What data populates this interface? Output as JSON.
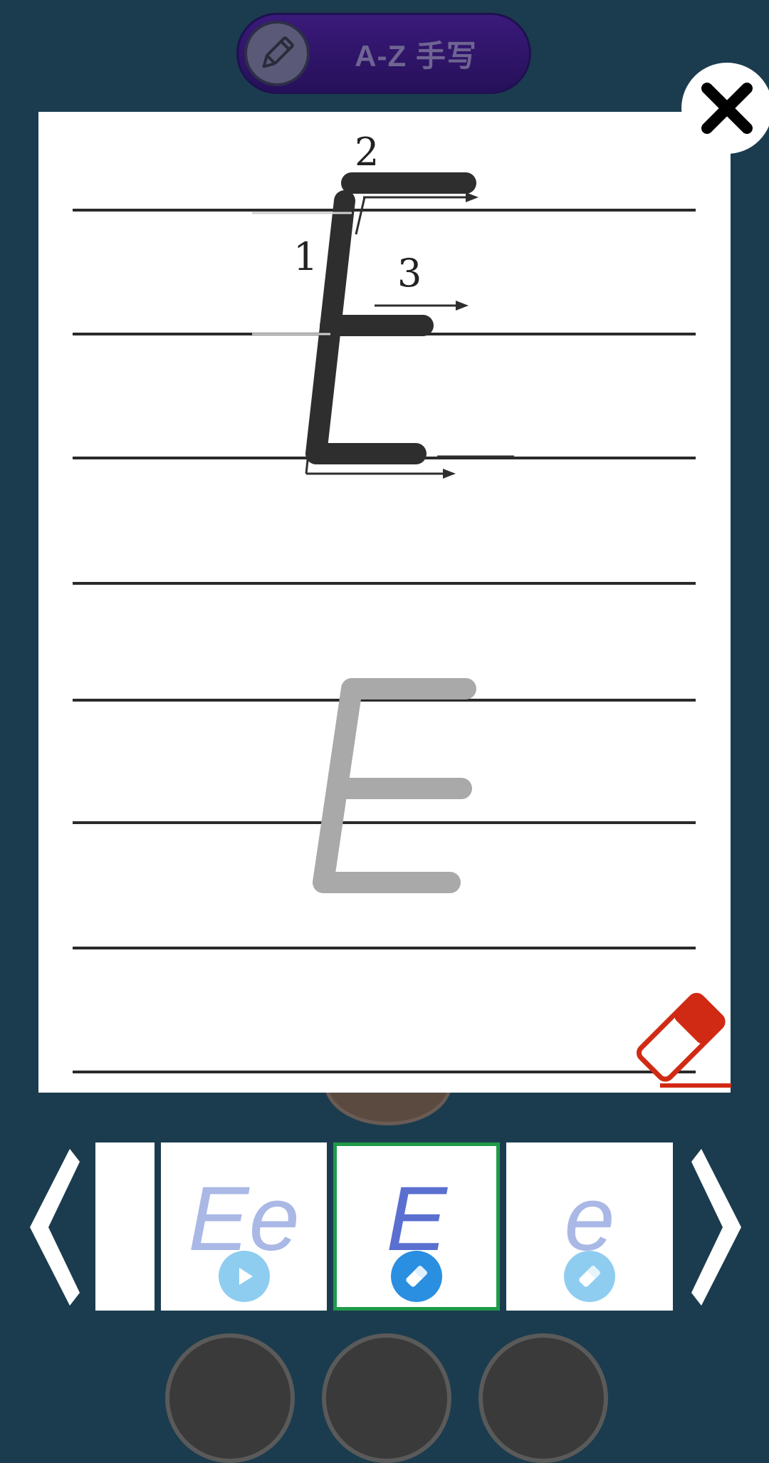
{
  "header": {
    "title": "A-Z 手写",
    "pencil_icon": "pencil-icon"
  },
  "close_icon": "close-icon",
  "letter": {
    "main": "E"
  },
  "stroke_numbers": [
    "1",
    "2",
    "3"
  ],
  "eraser_icon": "eraser-icon",
  "colors": {
    "background": "#1b3c4e",
    "pill": "#2e1366",
    "eraser_red": "#d12a14",
    "thumb_letter": "#aab8e6",
    "thumb_letter_selected": "#5a6fd0",
    "play_icon_bg": "#8fcdf0",
    "edit_icon_bg": "#2a8fe0",
    "selected_border": "#1f9a4a"
  },
  "carousel": {
    "items": [
      {
        "label": "",
        "icon": ""
      },
      {
        "label": "Ee",
        "icon": "play-icon"
      },
      {
        "label": "E",
        "icon": "eraser-icon",
        "selected": true
      },
      {
        "label": "e",
        "icon": "eraser-icon"
      }
    ],
    "prev_icon": "chevron-left-icon",
    "next_icon": "chevron-right-icon"
  }
}
